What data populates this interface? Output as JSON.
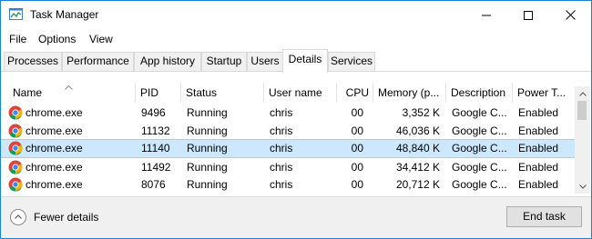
{
  "window": {
    "title": "Task Manager",
    "icon": "task-manager-icon",
    "controls": [
      "minimize-icon",
      "maximize-icon",
      "close-icon"
    ]
  },
  "menu": {
    "items": [
      {
        "label": "File"
      },
      {
        "label": "Options"
      },
      {
        "label": "View"
      }
    ]
  },
  "tabs": {
    "items": [
      {
        "label": "Processes"
      },
      {
        "label": "Performance"
      },
      {
        "label": "App history"
      },
      {
        "label": "Startup"
      },
      {
        "label": "Users"
      },
      {
        "label": "Details",
        "active": true
      },
      {
        "label": "Services"
      }
    ],
    "active": "Details"
  },
  "table": {
    "sort_column": "Name",
    "sort_direction": "ascending",
    "columns": [
      {
        "label": "Name"
      },
      {
        "label": "PID"
      },
      {
        "label": "Status"
      },
      {
        "label": "User name"
      },
      {
        "label": "CPU"
      },
      {
        "label": "Memory (p..."
      },
      {
        "label": "Description"
      },
      {
        "label": "Power T..."
      }
    ],
    "rows": [
      {
        "icon": "chrome-icon",
        "name": "chrome.exe",
        "pid": "9496",
        "status": "Running",
        "user": "chris",
        "cpu": "00",
        "memory": "3,352 K",
        "description": "Google C...",
        "power": "Enabled",
        "selected": false
      },
      {
        "icon": "chrome-icon",
        "name": "chrome.exe",
        "pid": "11132",
        "status": "Running",
        "user": "chris",
        "cpu": "00",
        "memory": "46,036 K",
        "description": "Google C...",
        "power": "Enabled",
        "selected": false
      },
      {
        "icon": "chrome-icon",
        "name": "chrome.exe",
        "pid": "11140",
        "status": "Running",
        "user": "chris",
        "cpu": "00",
        "memory": "48,840 K",
        "description": "Google C...",
        "power": "Enabled",
        "selected": true
      },
      {
        "icon": "chrome-icon",
        "name": "chrome.exe",
        "pid": "11492",
        "status": "Running",
        "user": "chris",
        "cpu": "00",
        "memory": "34,412 K",
        "description": "Google C...",
        "power": "Enabled",
        "selected": false
      },
      {
        "icon": "chrome-icon",
        "name": "chrome.exe",
        "pid": "8076",
        "status": "Running",
        "user": "chris",
        "cpu": "00",
        "memory": "20,712 K",
        "description": "Google C...",
        "power": "Enabled",
        "selected": false
      }
    ]
  },
  "footer": {
    "fewer_details_label": "Fewer details",
    "fewer_details_icon": "chevron-up-icon",
    "end_task_label": "End task"
  },
  "colors": {
    "window_border": "#1883d7",
    "selected_row": "#cce8ff",
    "selected_row_border": "#99d1ff",
    "chrome_red": "#db4437",
    "chrome_green": "#0f9d58",
    "chrome_yellow": "#f4b400",
    "chrome_blue": "#4285f4"
  }
}
